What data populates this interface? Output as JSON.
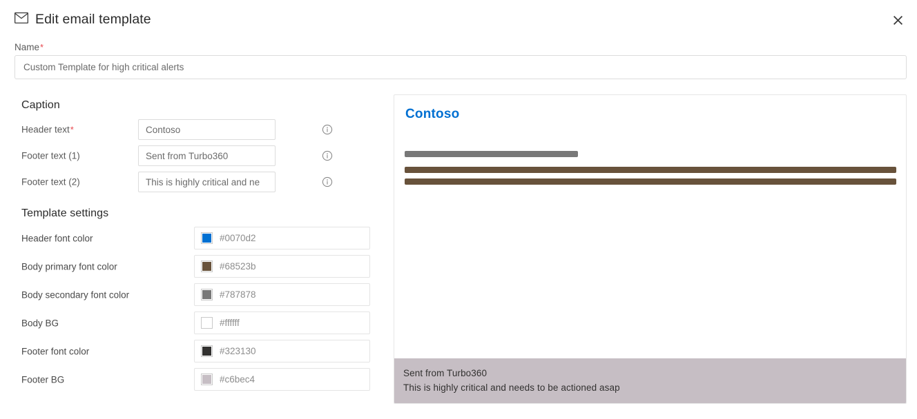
{
  "header": {
    "title": "Edit email template",
    "mail_icon": "mail-icon",
    "close_icon": "close-icon"
  },
  "name_field": {
    "label": "Name",
    "required_marker": "*",
    "value": "Custom Template for high critical alerts",
    "placeholder": "Name"
  },
  "caption": {
    "section_title": "Caption",
    "info_icon": "info-icon",
    "rows": [
      {
        "label": "Header text",
        "required": true,
        "required_marker": "*",
        "value": "Contoso"
      },
      {
        "label": "Footer text (1)",
        "required": false,
        "required_marker": "",
        "value": "Sent from Turbo360"
      },
      {
        "label": "Footer text (2)",
        "required": false,
        "required_marker": "",
        "value": "This is highly critical and ne"
      }
    ]
  },
  "template_settings": {
    "section_title": "Template settings",
    "rows": [
      {
        "label": "Header font color",
        "hex": "#0070d2"
      },
      {
        "label": "Body primary font color",
        "hex": "#68523b"
      },
      {
        "label": "Body secondary font color",
        "hex": "#787878"
      },
      {
        "label": "Body BG",
        "hex": "#ffffff"
      },
      {
        "label": "Footer font color",
        "hex": "#323130"
      },
      {
        "label": "Footer BG",
        "hex": "#c6bec4"
      }
    ]
  },
  "preview": {
    "heading": "Contoso",
    "heading_color": "#0070d2",
    "body_bg": "#ffffff",
    "bar_secondary_color": "#787878",
    "bar_primary_color": "#68523b",
    "footer_bg": "#c6bec4",
    "footer_font_color": "#323130",
    "footer_line_1": "Sent from Turbo360",
    "footer_line_2": "This is highly critical and needs to be actioned asap"
  }
}
